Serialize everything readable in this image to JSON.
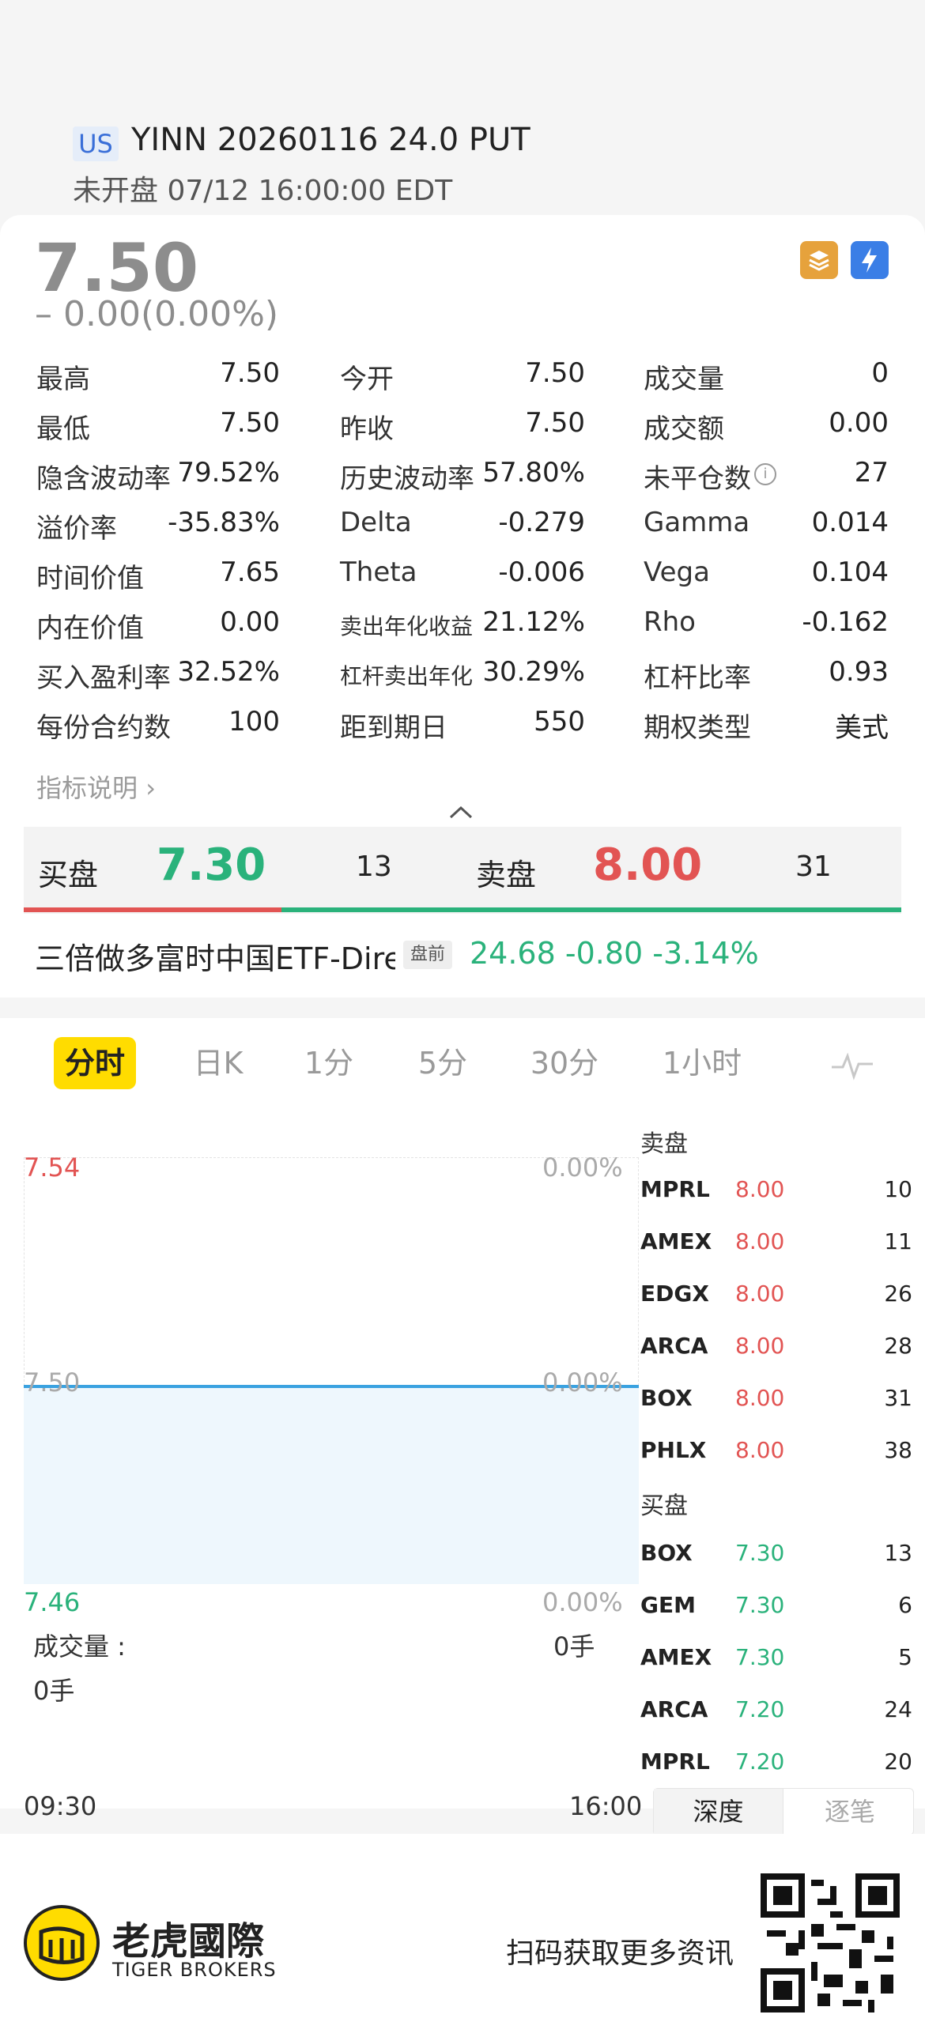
{
  "header": {
    "market_badge": "US",
    "ticker": "YINN 20260116 24.0 PUT",
    "status": "未开盘  07/12 16:00:00 EDT"
  },
  "quote": {
    "price": "7.50",
    "change": "– 0.00(0.00%)",
    "icons": [
      "layers-icon",
      "lightning-icon"
    ]
  },
  "stats": [
    [
      {
        "label": "最高",
        "value": "7.50"
      },
      {
        "label": "今开",
        "value": "7.50"
      },
      {
        "label": "成交量",
        "value": "0"
      }
    ],
    [
      {
        "label": "最低",
        "value": "7.50"
      },
      {
        "label": "昨收",
        "value": "7.50"
      },
      {
        "label": "成交额",
        "value": "0.00"
      }
    ],
    [
      {
        "label": "隐含波动率",
        "value": "79.52%"
      },
      {
        "label": "历史波动率",
        "value": "57.80%"
      },
      {
        "label": "未平仓数",
        "value": "27"
      }
    ],
    [
      {
        "label": "溢价率",
        "value": "-35.83%"
      },
      {
        "label": "Delta",
        "value": "-0.279"
      },
      {
        "label": "Gamma",
        "value": "0.014"
      }
    ],
    [
      {
        "label": "时间价值",
        "value": "7.65"
      },
      {
        "label": "Theta",
        "value": "-0.006"
      },
      {
        "label": "Vega",
        "value": "0.104"
      }
    ],
    [
      {
        "label": "内在价值",
        "value": "0.00"
      },
      {
        "label": "卖出年化收益",
        "value": "21.12%"
      },
      {
        "label": "Rho",
        "value": "-0.162"
      }
    ],
    [
      {
        "label": "买入盈利率",
        "value": "32.52%"
      },
      {
        "label": "杠杆卖出年化",
        "value": "30.29%"
      },
      {
        "label": "杠杆比率",
        "value": "0.93"
      }
    ],
    [
      {
        "label": "每份合约数",
        "value": "100"
      },
      {
        "label": "距到期日",
        "value": "550"
      },
      {
        "label": "期权类型",
        "value": "美式"
      }
    ]
  ],
  "help_link": "指标说明",
  "quote_bar": {
    "bid_label": "买盘",
    "bid_price": "7.30",
    "bid_qty": "13",
    "ask_label": "卖盘",
    "ask_price": "8.00",
    "ask_qty": "31"
  },
  "underlying": {
    "name": "三倍做多富时中国ETF-Direxion",
    "session_badge": "盘前",
    "quote": "24.68 -0.80 -3.14%"
  },
  "chart_tabs": [
    "分时",
    "日K",
    "1分",
    "5分",
    "30分",
    "1小时"
  ],
  "chart_data": {
    "type": "line",
    "x": [
      "09:30",
      "16:00"
    ],
    "series": [
      {
        "values": [
          7.5,
          7.5
        ]
      }
    ],
    "ylim": [
      7.46,
      7.54
    ],
    "y_ticks_left": [
      "7.54",
      "7.50",
      "7.46"
    ],
    "y_ticks_right": [
      "0.00%",
      "0.00%",
      "0.00%"
    ],
    "grid": true
  },
  "volume": {
    "label": "成交量 :",
    "right_value": "0手",
    "value": "0手"
  },
  "time_axis": {
    "start": "09:30",
    "end": "16:00"
  },
  "order_book": {
    "ask_title": "卖盘",
    "asks": [
      {
        "ex": "MPRL",
        "px": "8.00",
        "qty": "10"
      },
      {
        "ex": "AMEX",
        "px": "8.00",
        "qty": "11"
      },
      {
        "ex": "EDGX",
        "px": "8.00",
        "qty": "26"
      },
      {
        "ex": "ARCA",
        "px": "8.00",
        "qty": "28"
      },
      {
        "ex": "BOX",
        "px": "8.00",
        "qty": "31"
      },
      {
        "ex": "PHLX",
        "px": "8.00",
        "qty": "38"
      }
    ],
    "bid_title": "买盘",
    "bids": [
      {
        "ex": "BOX",
        "px": "7.30",
        "qty": "13"
      },
      {
        "ex": "GEM",
        "px": "7.30",
        "qty": "6"
      },
      {
        "ex": "AMEX",
        "px": "7.30",
        "qty": "5"
      },
      {
        "ex": "ARCA",
        "px": "7.20",
        "qty": "24"
      },
      {
        "ex": "MPRL",
        "px": "7.20",
        "qty": "20"
      }
    ],
    "tabs": [
      "深度",
      "逐笔"
    ]
  },
  "footer": {
    "brand_cn": "老虎國際",
    "brand_en": "TIGER BROKERS",
    "scan_text": "扫码获取更多资讯"
  },
  "colors": {
    "up": "#e25453",
    "down": "#2ab27b",
    "accent": "#ffdc00",
    "line": "#3aa2e0"
  }
}
